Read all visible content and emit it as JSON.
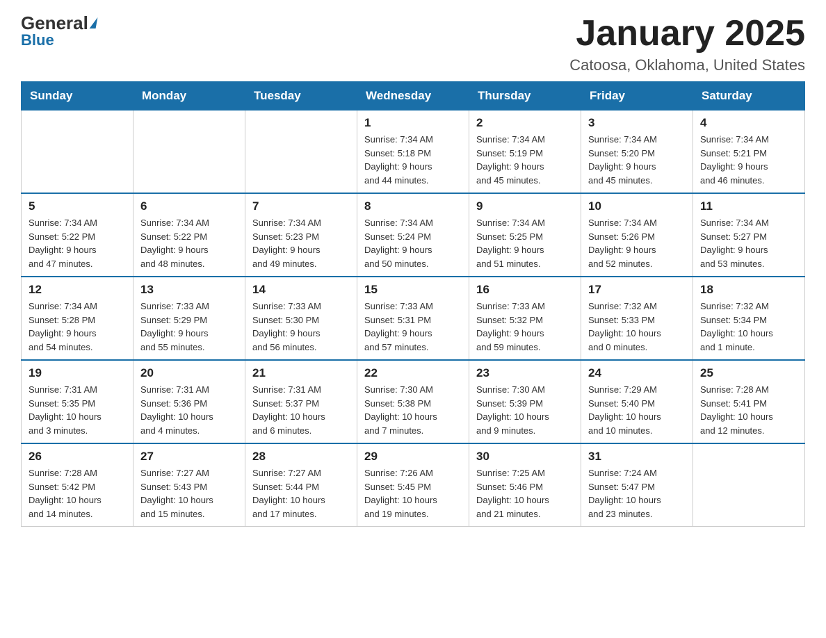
{
  "header": {
    "logo_general": "General",
    "logo_blue": "Blue",
    "month_year": "January 2025",
    "location": "Catoosa, Oklahoma, United States"
  },
  "weekdays": [
    "Sunday",
    "Monday",
    "Tuesday",
    "Wednesday",
    "Thursday",
    "Friday",
    "Saturday"
  ],
  "weeks": [
    [
      {
        "day": "",
        "info": ""
      },
      {
        "day": "",
        "info": ""
      },
      {
        "day": "",
        "info": ""
      },
      {
        "day": "1",
        "info": "Sunrise: 7:34 AM\nSunset: 5:18 PM\nDaylight: 9 hours\nand 44 minutes."
      },
      {
        "day": "2",
        "info": "Sunrise: 7:34 AM\nSunset: 5:19 PM\nDaylight: 9 hours\nand 45 minutes."
      },
      {
        "day": "3",
        "info": "Sunrise: 7:34 AM\nSunset: 5:20 PM\nDaylight: 9 hours\nand 45 minutes."
      },
      {
        "day": "4",
        "info": "Sunrise: 7:34 AM\nSunset: 5:21 PM\nDaylight: 9 hours\nand 46 minutes."
      }
    ],
    [
      {
        "day": "5",
        "info": "Sunrise: 7:34 AM\nSunset: 5:22 PM\nDaylight: 9 hours\nand 47 minutes."
      },
      {
        "day": "6",
        "info": "Sunrise: 7:34 AM\nSunset: 5:22 PM\nDaylight: 9 hours\nand 48 minutes."
      },
      {
        "day": "7",
        "info": "Sunrise: 7:34 AM\nSunset: 5:23 PM\nDaylight: 9 hours\nand 49 minutes."
      },
      {
        "day": "8",
        "info": "Sunrise: 7:34 AM\nSunset: 5:24 PM\nDaylight: 9 hours\nand 50 minutes."
      },
      {
        "day": "9",
        "info": "Sunrise: 7:34 AM\nSunset: 5:25 PM\nDaylight: 9 hours\nand 51 minutes."
      },
      {
        "day": "10",
        "info": "Sunrise: 7:34 AM\nSunset: 5:26 PM\nDaylight: 9 hours\nand 52 minutes."
      },
      {
        "day": "11",
        "info": "Sunrise: 7:34 AM\nSunset: 5:27 PM\nDaylight: 9 hours\nand 53 minutes."
      }
    ],
    [
      {
        "day": "12",
        "info": "Sunrise: 7:34 AM\nSunset: 5:28 PM\nDaylight: 9 hours\nand 54 minutes."
      },
      {
        "day": "13",
        "info": "Sunrise: 7:33 AM\nSunset: 5:29 PM\nDaylight: 9 hours\nand 55 minutes."
      },
      {
        "day": "14",
        "info": "Sunrise: 7:33 AM\nSunset: 5:30 PM\nDaylight: 9 hours\nand 56 minutes."
      },
      {
        "day": "15",
        "info": "Sunrise: 7:33 AM\nSunset: 5:31 PM\nDaylight: 9 hours\nand 57 minutes."
      },
      {
        "day": "16",
        "info": "Sunrise: 7:33 AM\nSunset: 5:32 PM\nDaylight: 9 hours\nand 59 minutes."
      },
      {
        "day": "17",
        "info": "Sunrise: 7:32 AM\nSunset: 5:33 PM\nDaylight: 10 hours\nand 0 minutes."
      },
      {
        "day": "18",
        "info": "Sunrise: 7:32 AM\nSunset: 5:34 PM\nDaylight: 10 hours\nand 1 minute."
      }
    ],
    [
      {
        "day": "19",
        "info": "Sunrise: 7:31 AM\nSunset: 5:35 PM\nDaylight: 10 hours\nand 3 minutes."
      },
      {
        "day": "20",
        "info": "Sunrise: 7:31 AM\nSunset: 5:36 PM\nDaylight: 10 hours\nand 4 minutes."
      },
      {
        "day": "21",
        "info": "Sunrise: 7:31 AM\nSunset: 5:37 PM\nDaylight: 10 hours\nand 6 minutes."
      },
      {
        "day": "22",
        "info": "Sunrise: 7:30 AM\nSunset: 5:38 PM\nDaylight: 10 hours\nand 7 minutes."
      },
      {
        "day": "23",
        "info": "Sunrise: 7:30 AM\nSunset: 5:39 PM\nDaylight: 10 hours\nand 9 minutes."
      },
      {
        "day": "24",
        "info": "Sunrise: 7:29 AM\nSunset: 5:40 PM\nDaylight: 10 hours\nand 10 minutes."
      },
      {
        "day": "25",
        "info": "Sunrise: 7:28 AM\nSunset: 5:41 PM\nDaylight: 10 hours\nand 12 minutes."
      }
    ],
    [
      {
        "day": "26",
        "info": "Sunrise: 7:28 AM\nSunset: 5:42 PM\nDaylight: 10 hours\nand 14 minutes."
      },
      {
        "day": "27",
        "info": "Sunrise: 7:27 AM\nSunset: 5:43 PM\nDaylight: 10 hours\nand 15 minutes."
      },
      {
        "day": "28",
        "info": "Sunrise: 7:27 AM\nSunset: 5:44 PM\nDaylight: 10 hours\nand 17 minutes."
      },
      {
        "day": "29",
        "info": "Sunrise: 7:26 AM\nSunset: 5:45 PM\nDaylight: 10 hours\nand 19 minutes."
      },
      {
        "day": "30",
        "info": "Sunrise: 7:25 AM\nSunset: 5:46 PM\nDaylight: 10 hours\nand 21 minutes."
      },
      {
        "day": "31",
        "info": "Sunrise: 7:24 AM\nSunset: 5:47 PM\nDaylight: 10 hours\nand 23 minutes."
      },
      {
        "day": "",
        "info": ""
      }
    ]
  ]
}
